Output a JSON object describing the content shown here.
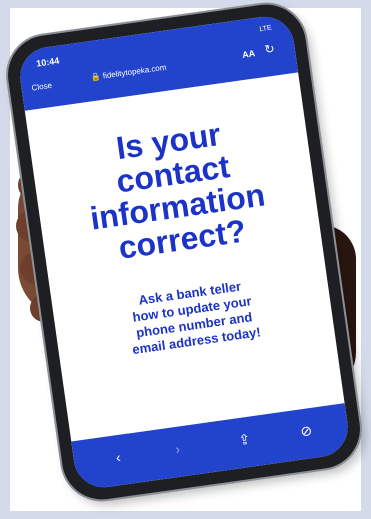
{
  "browser": {
    "time": "10:44",
    "status": "LTE",
    "close_label": "Close",
    "url": "🔒 fidelitytopeka.com",
    "text_size_label": "AA"
  },
  "message": {
    "headline_lines": [
      "Is your",
      "contact",
      "information",
      "correct?"
    ],
    "body_lines": [
      "Ask a bank teller",
      "how to update your",
      "phone number and",
      "email address today!"
    ]
  },
  "toolbar": {
    "back_icon": "‹",
    "forward_icon": "›",
    "share_icon": "⇪",
    "compass_icon": "⊘"
  },
  "colors": {
    "accent": "#2244cc",
    "text": "#1b33c6"
  }
}
